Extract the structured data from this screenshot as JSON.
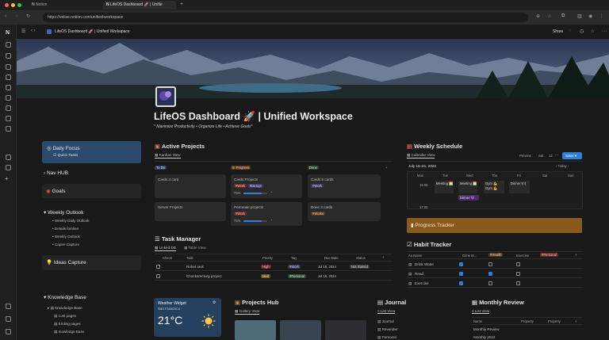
{
  "browser": {
    "tabs": [
      {
        "label": "Notion"
      },
      {
        "label": "LifeOS Dashboard 🚀 | Unifie"
      }
    ],
    "url": "https://velise.notion.com/unified-workspace",
    "colors": {
      "red": "#ff5f57",
      "yellow": "#febc2e",
      "green": "#28c840"
    }
  },
  "topbar": {
    "breadcrumb": "LifeOS Dashboard 🚀 | Unified Workspace",
    "share": "Share"
  },
  "page": {
    "title": "LifeOS Dashboard 🚀 | Unified Workspace",
    "subtitle": "* Maximize Productivity • Organize Life • Achieve Goals*"
  },
  "left": {
    "daily_focus": "Daily Focus",
    "quick_tasks": "Quick Tasks",
    "nav_hub": "Nav HUB",
    "goals": "Goals",
    "weekly_outlook": "Weekly Outlook",
    "weekly_items": [
      "Weekly Daily Outlook",
      "Details fomline",
      "Weekly Outlook",
      "Capire Capture"
    ],
    "ideas_capture": "Ideas Capture",
    "knowledge_base": "Knowledge Base",
    "kb_items": [
      "Knowledge Base",
      "Lust pages",
      "Ending pages",
      "Inowledge Base"
    ]
  },
  "projects": {
    "title": "Active Projects",
    "view": "Kanban View",
    "columns": [
      {
        "label": "To Do",
        "color": "#2a4563",
        "cards": [
          {
            "title": "Cards 3 card",
            "tags": [],
            "pct": ""
          },
          {
            "title": "Server Projects",
            "tags": [],
            "pct": ""
          }
        ]
      },
      {
        "label": "In Progress",
        "color": "#5a3b20",
        "cards": [
          {
            "title": "Cards Projects",
            "tags": [
              "#Work",
              "#Design"
            ],
            "pct": "75%",
            "progress": 0.75
          },
          {
            "title": "Permeale projects",
            "tags": [
              "#Work"
            ],
            "pct": "75%",
            "progress": 0.75
          }
        ]
      },
      {
        "label": "Done",
        "color": "#2d4a34",
        "cards": [
          {
            "title": "Cards 5 cards",
            "tags": [
              "#Work"
            ],
            "pct": ""
          },
          {
            "title": "Done 3 cards",
            "tags": [
              "#Works"
            ],
            "pct": ""
          }
        ]
      }
    ]
  },
  "tasks": {
    "title": "Task Manager",
    "views": [
      "Linked DB",
      "Table View"
    ],
    "headers": [
      "Check",
      "Task",
      "Priority",
      "Tag",
      "Due Date",
      "Status"
    ],
    "rows": [
      {
        "task": "Robot task",
        "priority": "High",
        "tag": "#Work",
        "due": "Jul 15, 2024",
        "status": "Not Started"
      },
      {
        "task": "Chocksrecturg project",
        "priority": "Med",
        "tag": "#Personal",
        "due": "Jul 16, 2024",
        "status": ""
      }
    ]
  },
  "schedule": {
    "title": "Weekly Schedule",
    "view": "Calendar View",
    "range": "July 15–21, 2024",
    "preview": "Preview",
    "sat": "Sat",
    "n12": "12",
    "save": "Save",
    "today": "Today",
    "days": [
      "Mon",
      "Tue",
      "Wed",
      "Thu",
      "Fri",
      "Sat"
    ],
    "times": [
      "15:00",
      "17:00"
    ],
    "events": [
      "Meeting 🌅",
      "Meeting 🌅",
      "Gym 💪\nGym 💪",
      "Dinner 🍽",
      "Dinner 💜"
    ]
  },
  "progress_tracker": {
    "title": "Progress Tracker",
    "color": "#8a5a1c"
  },
  "habits": {
    "title": "Habit Tracker",
    "headers": [
      "Aa Name",
      "Drink W...",
      "#Health",
      "Exercise",
      "#Personal"
    ],
    "rows": [
      {
        "name": "Drink Water",
        "c1": true,
        "c2": false
      },
      {
        "name": "Read",
        "c1": true,
        "c2": true
      },
      {
        "name": "Exercise",
        "c1": true,
        "c2": false
      }
    ]
  },
  "weather": {
    "title": "Weather Widget",
    "city": "San Francisco",
    "temp": "21°C"
  },
  "projects_hub": {
    "title": "Projects Hub",
    "view": "Gallery View"
  },
  "journal": {
    "title": "Journal",
    "view": "List View",
    "items": [
      "Journal",
      "Revender",
      "Personal"
    ]
  },
  "monthly": {
    "title": "Monthly Review",
    "view": "List View",
    "headers": [
      "Name",
      "Property",
      "Property"
    ],
    "items": [
      "Monthly Review",
      "Monthly 2024"
    ]
  }
}
